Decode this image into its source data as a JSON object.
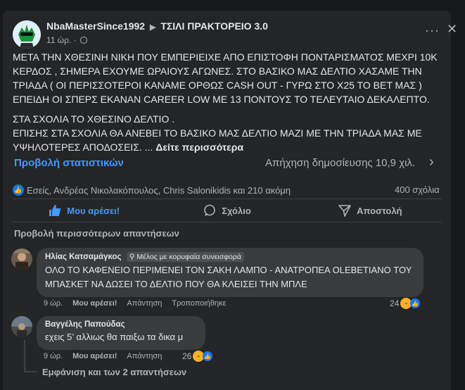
{
  "post": {
    "author": "NbaMasterSince1992",
    "separator": "▶",
    "group": "ΤΣΙΛΙ ΠΡΑΚΤΟΡΕΙΟ 3.0",
    "time": "11 ώρ. ·",
    "more_icon": "more-dots-icon",
    "close_icon": "close-icon",
    "text_p1": "ΜΕΤΑ ΤΗΝ ΧΘΕΣΙΝΗ ΝΙΚΗ ΠΟΥ ΕΜΠΕΡΙΕΙΧΕ ΑΠΟ ΕΠΙΣΤΟΦΗ ΠΟΝΤΑΡΙΣΜΑΤΟΣ ΜΕΧΡΙ 10Κ ΚΕΡΔΟΣ , ΣΗΜΕΡΑ ΕΧΟΥΜΕ ΩΡΑΙΟΥΣ ΑΓΩΝΕΣ. ΣΤΟ ΒΑΣΙΚΟ ΜΑΣ ΔΕΛΤΙΟ ΧΑΣΑΜΕ ΤΗΝ ΤΡΙΑΔΑ ( ΟΙ ΠΕΡΙΣΣΟΤΕΡΟΙ ΚΑΝΑΜΕ ΟΡΘΩΣ CASH OUT - ΓΥΡΩ ΣΤΟ Χ25 ΤΟ BET ΜΑΣ ) ΕΠΕΙΔΗ ΟΙ ΣΠΕΡΣ ΕΚΑΝΑΝ CAREER LOW ΜΕ 13 ΠΟΝΤΟΥΣ ΤΟ ΤΕΛΕΥΤΑΙΟ ΔΕΚΑΛΕΠΤΟ.",
    "text_p2": "ΣΤΑ ΣΧΟΛΙΑ ΤΟ ΧΘΕΣΙΝΟ ΔΕΛΤΙΟ .\nΕΠΙΣΗΣ ΣΤΑ ΣΧΟΛΙΑ ΘΑ ΑΝΕΒΕΙ ΤΟ ΒΑΣΙΚΟ ΜΑΣ ΔΕΛΤΙΟ ΜΑΖΙ ΜΕ ΤΗΝ ΤΡΙΑΔΑ ΜΑΣ ΜΕ ΥΨΗΛΟΤΕΡΕΣ ΑΠΟΔΟΣΕΙΣ. ...",
    "see_more": "Δείτε περισσότερα",
    "stats_link": "Προβολή στατιστικών",
    "reach": "Απήχηση δημοσίευσης 10,9 χιλ.",
    "reactions_text": "Εσείς, Ανδρέας Νικολακόπουλος, Chris Salonikidis και 210 ακόμη",
    "comments_count": "400 σχόλια"
  },
  "actions": {
    "like": "Μου αρέσει!",
    "comment": "Σχόλιο",
    "share": "Αποστολή"
  },
  "more_replies": "Προβολή περισσότερων απαντήσεων",
  "comments": [
    {
      "name": "Ηλίας Κατσαμάγκος",
      "badge": "Μέλος με κορυφαία συνεισφορά",
      "text": "ΟΛΟ ΤΟ ΚΑΦΕΝΕΙΟ ΠΕΡΙΜΕΝΕΙ ΤΟΝ ΣΑΚΗ ΛΑΜΠΟ - ΑΝΑΤΡΟΠΕΑ OLEBETIANO ΤΟΥ ΜΠΑΣΚΕΤ ΝΑ ΔΩΣΕΙ ΤΟ ΔΕΛΤΙΟ ΠΟΥ ΘΑ ΚΛΕΙΣΕΙ ΤΗΝ ΜΠΛΕ",
      "time": "9 ώρ.",
      "like": "Μου αρέσει!",
      "reply": "Απάντηση",
      "edit": "Τροποποιήθηκε",
      "reactions": "24"
    },
    {
      "name": "Βαγγέλης Παπούδας",
      "text": "εχεις 5’ αλλιως θα παιξω τα δικα μ",
      "time": "9 ώρ.",
      "like": "Μου αρέσει!",
      "reply": "Απάντηση",
      "reactions": "26"
    }
  ],
  "show_replies": "Εμφάνιση και των 2 απαντήσεων",
  "colors": {
    "accent": "#4599ff",
    "card": "#242526",
    "bubble": "#3a3b3c"
  }
}
